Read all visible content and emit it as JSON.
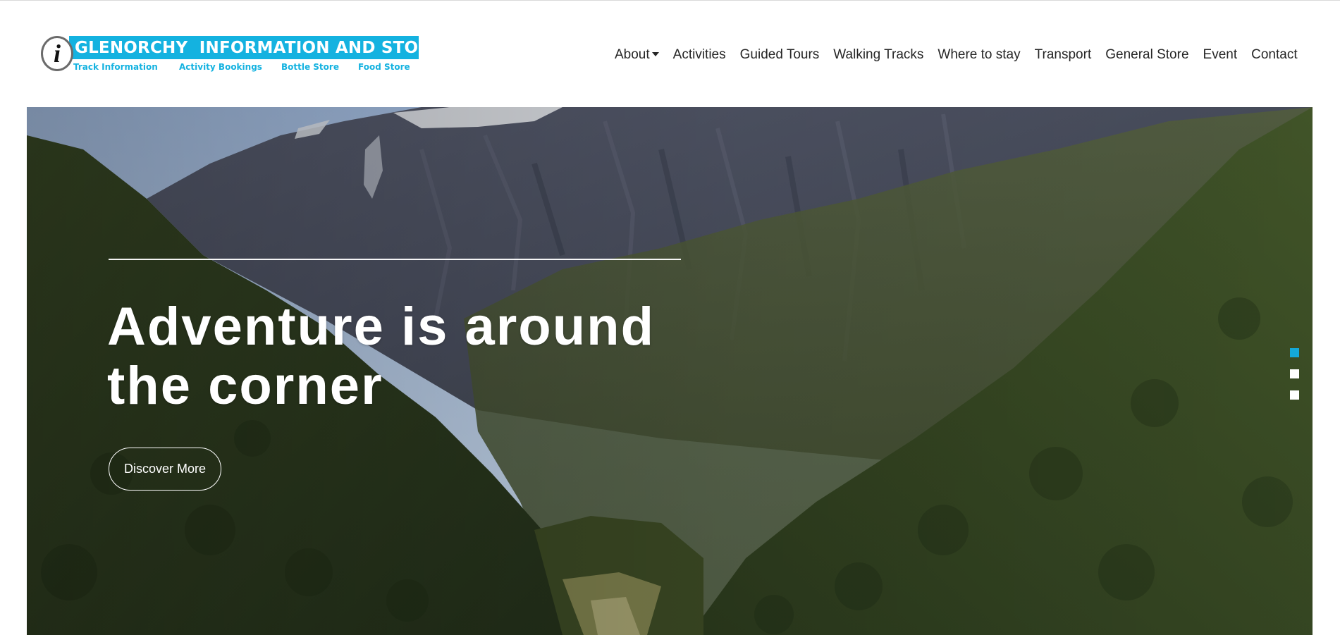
{
  "logo": {
    "glyph": "i",
    "title": "GLENORCHY  INFORMATION AND STORE",
    "sub_links": [
      "Track Information",
      "Activity Bookings",
      "Bottle Store",
      "Food Store"
    ],
    "brand_color": "#14b2e0"
  },
  "nav": {
    "items": [
      {
        "label": "About",
        "has_dropdown": true,
        "icon": "caret-down-icon"
      },
      {
        "label": "Activities"
      },
      {
        "label": "Guided Tours"
      },
      {
        "label": "Walking Tracks"
      },
      {
        "label": "Where to stay"
      },
      {
        "label": "Transport"
      },
      {
        "label": "General Store"
      },
      {
        "label": "Event"
      },
      {
        "label": "Contact"
      }
    ]
  },
  "hero": {
    "title": "Adventure is around the corner",
    "button_label": "Discover More",
    "background": "mountain valley photo",
    "slides": {
      "count": 3,
      "active_index": 0
    },
    "active_dot_color": "#14a9d9"
  }
}
